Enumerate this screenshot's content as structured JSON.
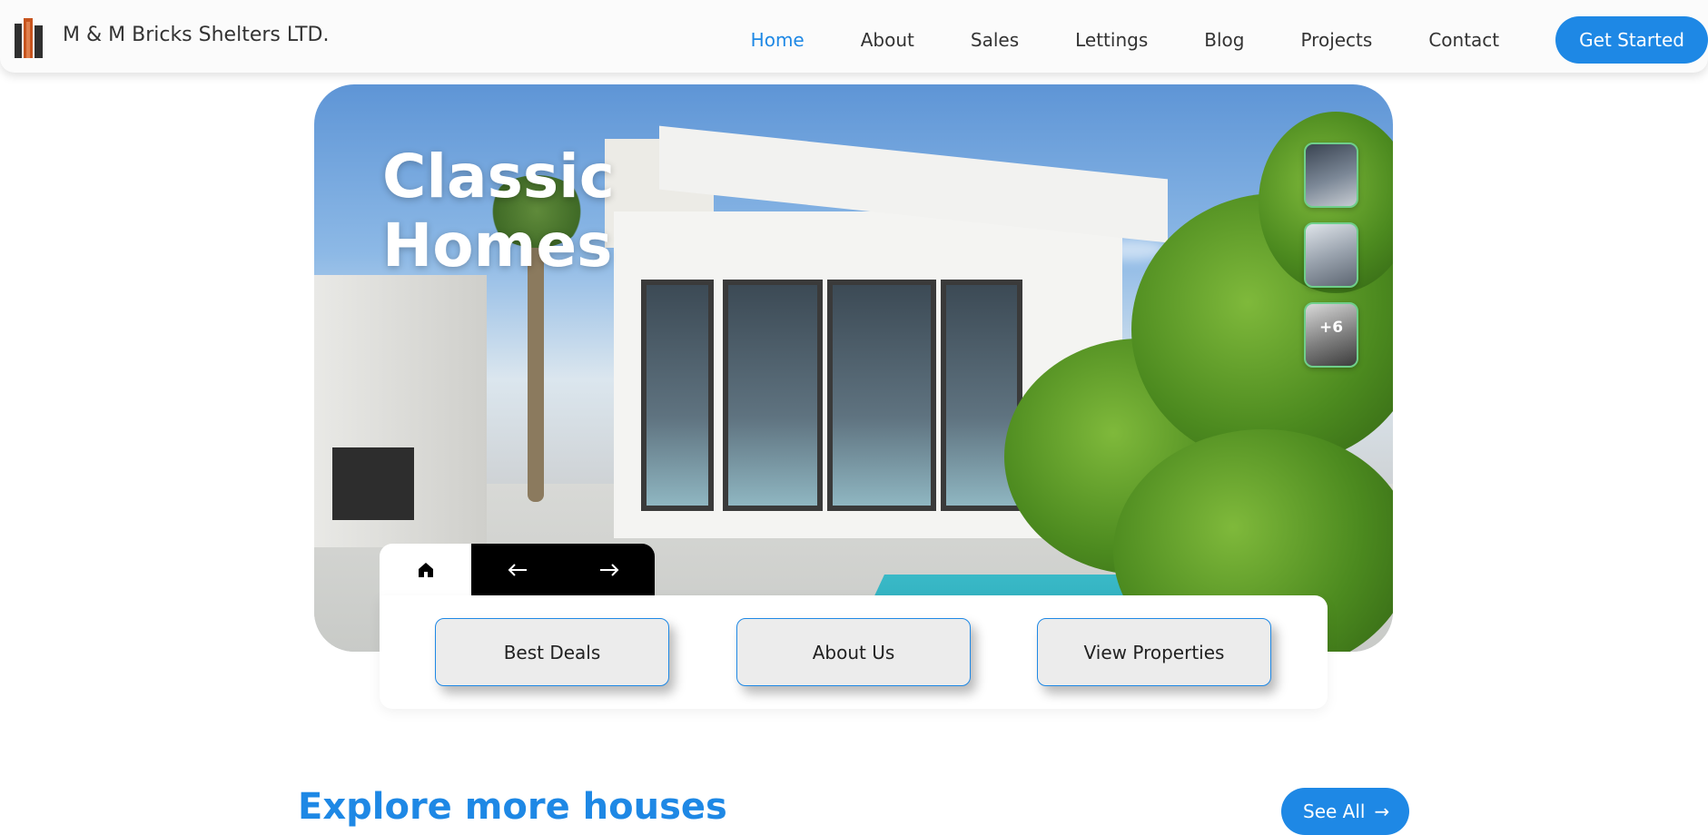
{
  "brand": {
    "name": "M & M Bricks Shelters LTD.",
    "logo_icon": "building-logo-icon"
  },
  "nav": {
    "links": [
      "Home",
      "About",
      "Sales",
      "Lettings",
      "Blog",
      "Projects",
      "Contact"
    ],
    "active": "Home",
    "cta_label": "Get Started"
  },
  "hero": {
    "title_line1": "Classic",
    "title_line2": "Homes",
    "thumbnails_more": "+6",
    "tabs": {
      "home_icon": "home-icon",
      "prev_icon": "arrow-left-icon",
      "next_icon": "arrow-right-icon"
    },
    "actions": [
      "Best Deals",
      "About Us",
      "View Properties"
    ]
  },
  "explore": {
    "title": "Explore more houses",
    "see_all_label": "See All"
  },
  "colors": {
    "accent": "#1e88e5",
    "thumb_border": "#6fcf8a"
  }
}
